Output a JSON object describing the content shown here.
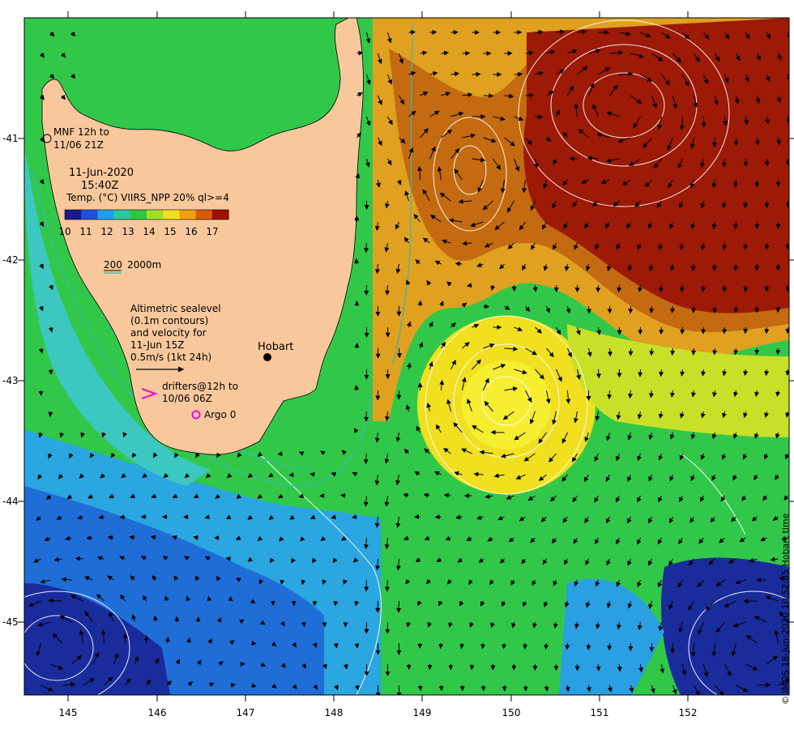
{
  "map": {
    "lon_ticks": [
      "145",
      "146",
      "147",
      "148",
      "149",
      "150",
      "151",
      "152"
    ],
    "lat_ticks": [
      "-41",
      "-42",
      "-43",
      "-44",
      "-45"
    ],
    "lon_range": [
      144.5,
      153.0
    ],
    "lat_range": [
      -45.6,
      -40.1
    ]
  },
  "legend": {
    "mnf_text": "MNF 12h to",
    "mnf_text2": "11/06 21Z",
    "date": "11-Jun-2020",
    "time": "15:40Z",
    "product": "Temp. (°C) VIIRS_NPP 20% ql>=4",
    "colorbar_labels": [
      "10",
      "11",
      "12",
      "13",
      "14",
      "15",
      "16",
      "17"
    ],
    "colorbar_colors": [
      "#1a1a8c",
      "#1e50e0",
      "#1ea0f0",
      "#28c8a0",
      "#2ec840",
      "#9ee02a",
      "#f0e020",
      "#f0a010",
      "#d85a08",
      "#a01000"
    ],
    "contour_label_a": "200",
    "contour_label_b": "2000m",
    "sealevel_l1": "Altimetric sealevel",
    "sealevel_l2": "(0.1m contours)",
    "sealevel_l3": "and velocity for",
    "sealevel_l4": "11-Jun 15Z",
    "sealevel_l5": "0.5m/s (1kt 24h)",
    "drifters_l1": "drifters@12h to",
    "drifters_l2": "10/06 06Z",
    "argo": "Argo 0",
    "city": "Hobart"
  },
  "credit": "© IMOS 18-Jun-2020 10:52:35 Hobart time"
}
